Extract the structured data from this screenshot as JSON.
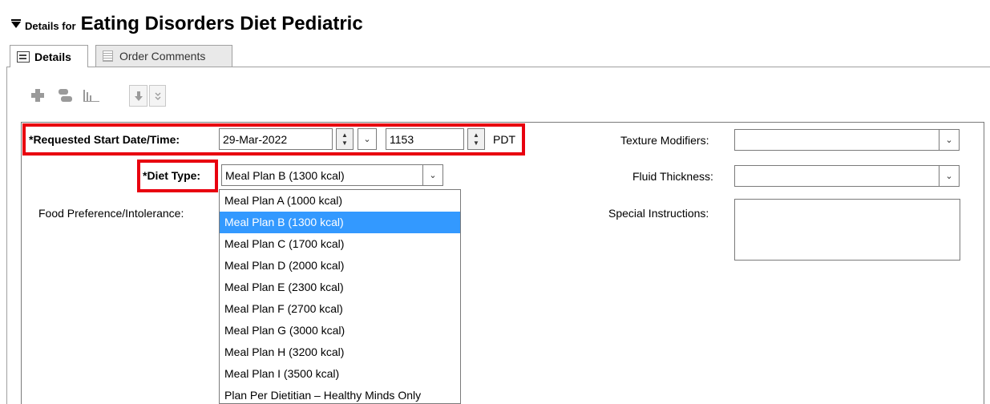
{
  "header": {
    "prefix": "Details for",
    "title": "Eating Disorders Diet Pediatric"
  },
  "tabs": [
    {
      "label": "Details",
      "active": true
    },
    {
      "label": "Order Comments",
      "active": false
    }
  ],
  "toolbar": {
    "icons": [
      "add-icon",
      "pill-icon",
      "bar-chart-icon",
      "move-down-icon",
      "expand-more-icon"
    ]
  },
  "form": {
    "start_datetime": {
      "label": "*Requested Start Date/Time:",
      "date": "29-Mar-2022",
      "time": "1153",
      "timezone": "PDT"
    },
    "diet_type": {
      "label": "*Diet Type:",
      "value": "Meal Plan B (1300 kcal)",
      "options": [
        "Meal Plan A (1000 kcal)",
        "Meal Plan B (1300 kcal)",
        "Meal Plan C (1700 kcal)",
        "Meal Plan D (2000 kcal)",
        "Meal Plan E (2300 kcal)",
        "Meal Plan F (2700 kcal)",
        "Meal Plan G (3000 kcal)",
        "Meal Plan H (3200 kcal)",
        "Meal Plan I (3500 kcal)",
        "Plan Per Dietitian – Healthy Minds Only"
      ],
      "selected_index": 1
    },
    "food_preference": {
      "label": "Food Preference/Intolerance:"
    },
    "texture_modifiers": {
      "label": "Texture Modifiers:",
      "value": ""
    },
    "fluid_thickness": {
      "label": "Fluid Thickness:",
      "value": ""
    },
    "special_instructions": {
      "label": "Special Instructions:",
      "value": ""
    }
  },
  "colors": {
    "highlight": "#e8000f",
    "selection": "#3399ff",
    "border": "#7a7a7a"
  }
}
